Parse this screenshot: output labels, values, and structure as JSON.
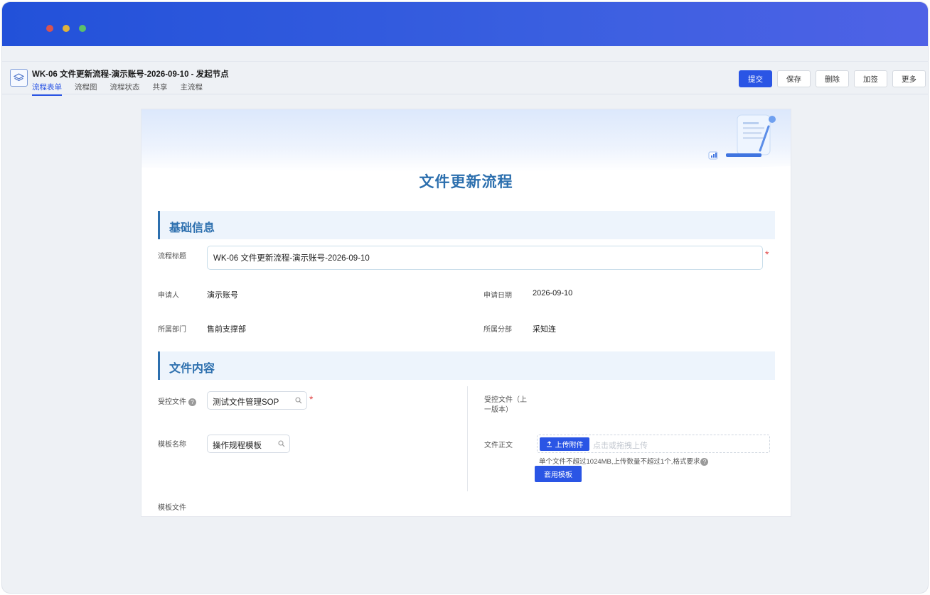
{
  "window": {
    "controls": [
      "close",
      "minimize",
      "maximize"
    ]
  },
  "header": {
    "title": "WK-06 文件更新流程-演示账号-2026-09-10 - 发起节点",
    "tabs": [
      {
        "label": "流程表单",
        "active": true
      },
      {
        "label": "流程图"
      },
      {
        "label": "流程状态"
      },
      {
        "label": "共享"
      },
      {
        "label": "主流程"
      }
    ],
    "actions": {
      "submit": "提交",
      "save": "保存",
      "delete": "删除",
      "add_sign": "加签",
      "more": "更多"
    }
  },
  "form": {
    "title": "文件更新流程",
    "section_basic": "基础信息",
    "section_content": "文件内容",
    "fields": {
      "flow_title_label": "流程标题",
      "flow_title_value": "WK-06 文件更新流程-演示账号-2026-09-10",
      "applicant_label": "申请人",
      "applicant_value": "演示账号",
      "apply_date_label": "申请日期",
      "apply_date_value": "2026-09-10",
      "dept_label": "所属部门",
      "dept_value": "售前支撑部",
      "branch_label": "所属分部",
      "branch_value": "采知连",
      "controlled_file_label": "受控文件",
      "controlled_file_value": "测试文件管理SOP",
      "controlled_prev_label_line1": "受控文件（上",
      "controlled_prev_label_line2": "一版本）",
      "template_name_label": "模板名称",
      "template_name_value": "操作规程模板",
      "doc_body_label": "文件正文",
      "upload_button": "上传附件",
      "upload_placeholder": "点击或拖拽上传",
      "upload_tip": "单个文件不超过1024MB,上传数量不超过1个,格式要求",
      "use_template_button": "套用模板",
      "template_file_label": "模板文件",
      "required_mark": "*",
      "help_mark": "?"
    }
  },
  "colors": {
    "titlebar_start": "#2251d9",
    "titlebar_end": "#4f62e6",
    "primary": "#2a55e5",
    "form_title": "#2c6fae",
    "section_bg": "#edf4fc",
    "required": "#e04848"
  }
}
